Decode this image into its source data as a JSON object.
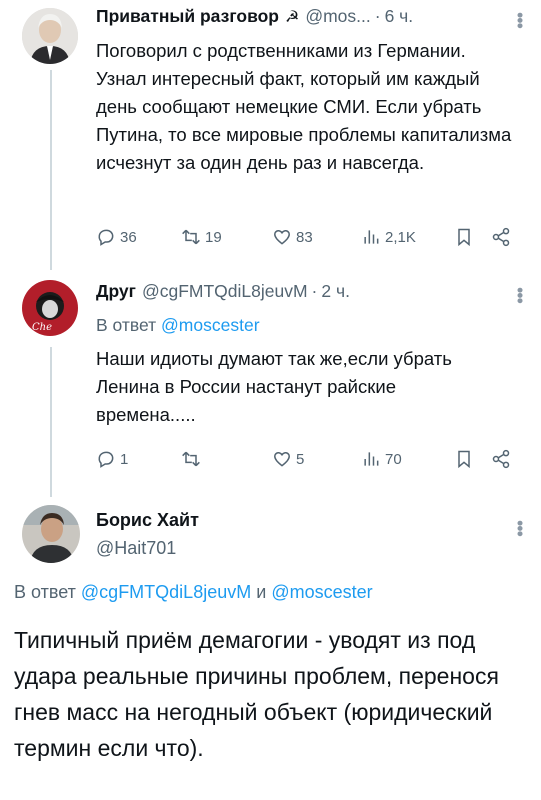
{
  "tweets": [
    {
      "name": "Приватный разговор",
      "symbol": "☭",
      "handle": "@mos...",
      "sep": "·",
      "time": "6 ч.",
      "text": "Поговорил с родственниками из Германии. Узнал интересный факт, который им каждый день сообщают немецкие СМИ. Если убрать Путина, то все мировые проблемы капитализма исчезнут за один день раз и навсегда.",
      "actions": {
        "replies": "36",
        "retweets": "19",
        "likes": "83",
        "views": "2,1K"
      }
    },
    {
      "name": "Друг",
      "handle": "@cgFMTQdiL8jeuvM",
      "sep": "·",
      "time": "2 ч.",
      "reply_prefix": "В ответ",
      "reply_to": "@moscester",
      "text": "Наши идиоты думают так же,если убрать Ленина в России настанут райские времена.....",
      "actions": {
        "replies": "1",
        "retweets": "",
        "likes": "5",
        "views": "70"
      }
    }
  ],
  "main": {
    "name": "Борис Хайт",
    "handle": "@Hait701",
    "reply_prefix": "В ответ",
    "reply_to_1": "@cgFMTQdiL8jeuvM",
    "reply_and": "и",
    "reply_to_2": "@moscester",
    "text": "Типичный приём демагогии - уводят из под удара реальные причины проблем, перенося гнев масс на негодный объект (юридический термин если что)."
  },
  "icons": [
    "reply-icon",
    "retweet-icon",
    "like-icon",
    "views-icon",
    "bookmark-icon",
    "share-icon",
    "more-icon"
  ],
  "colors": {
    "link": "#1d9bf0",
    "muted": "#536471",
    "line": "#cfd9de"
  }
}
